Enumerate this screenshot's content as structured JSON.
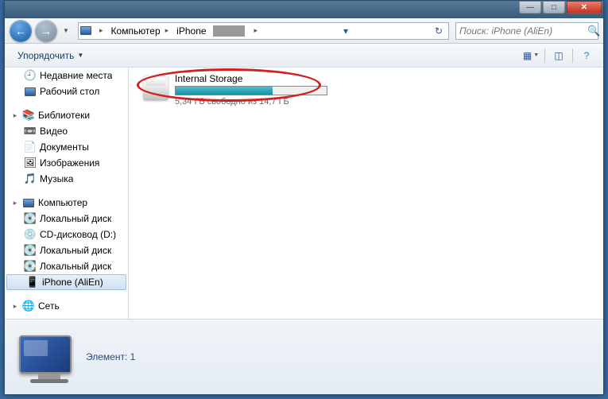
{
  "titlebar": {
    "min": "—",
    "max": "□",
    "close": "✕"
  },
  "nav": {
    "back": "←",
    "fwd": "→"
  },
  "breadcrumbs": {
    "root_icon": "🖥",
    "items": [
      "Компьютер",
      "iPhone"
    ]
  },
  "search": {
    "placeholder": "Поиск: iPhone (AliEn)"
  },
  "toolbar": {
    "organize": "Упорядочить"
  },
  "sidebar": {
    "favorites": [
      {
        "icon": "🕘",
        "label": "Недавние места"
      },
      {
        "icon": "🖥",
        "label": "Рабочий стол"
      }
    ],
    "libraries_label": "Библиотеки",
    "libraries": [
      {
        "icon": "📼",
        "label": "Видео"
      },
      {
        "icon": "📄",
        "label": "Документы"
      },
      {
        "icon": "🖼",
        "label": "Изображения"
      },
      {
        "icon": "🎵",
        "label": "Музыка"
      }
    ],
    "computer_label": "Компьютер",
    "computer": [
      {
        "icon": "💽",
        "label": "Локальный диск"
      },
      {
        "icon": "💿",
        "label": "CD-дисковод (D:)"
      },
      {
        "icon": "💽",
        "label": "Локальный диск"
      },
      {
        "icon": "💽",
        "label": "Локальный диск"
      },
      {
        "icon": "📱",
        "label": "iPhone (AliEn)",
        "selected": true
      }
    ],
    "network_label": "Сеть"
  },
  "storage": {
    "name": "Internal Storage",
    "free_text": "5,34 ГБ свободно из 14,7 ГБ",
    "used_percent": 64
  },
  "details": {
    "text": "Элемент: 1"
  }
}
